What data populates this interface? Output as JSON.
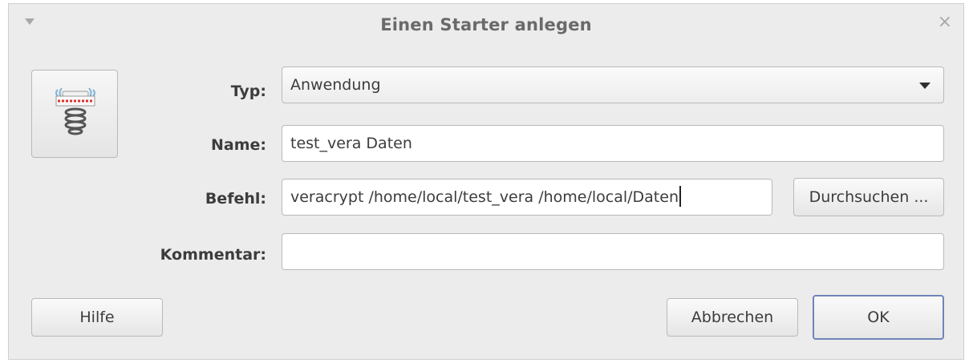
{
  "window": {
    "title": "Einen Starter anlegen",
    "menu_icon": "triangle-down-icon",
    "close_glyph": "×"
  },
  "form": {
    "type_label": "Typ:",
    "type_value": "Anwendung",
    "name_label": "Name:",
    "name_value": "test_vera Daten",
    "command_label": "Befehl:",
    "command_value": "veracrypt /home/local/test_vera /home/local/Daten",
    "browse_label": "Durchsuchen ...",
    "comment_label": "Kommentar:",
    "comment_value": ""
  },
  "buttons": {
    "help": "Hilfe",
    "cancel": "Abbrechen",
    "ok": "OK"
  },
  "colors": {
    "dialog_bg": "#ececec",
    "default_button_border": "#6f84b8"
  },
  "icon": {
    "name": "launcher-spring-icon"
  }
}
